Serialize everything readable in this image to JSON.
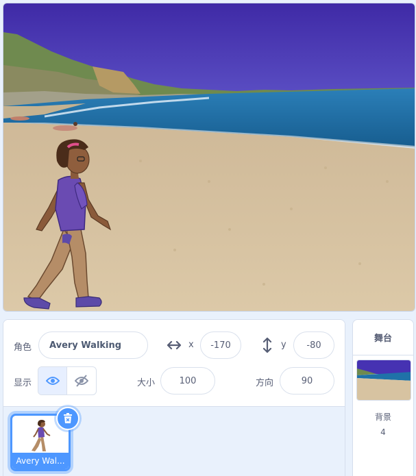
{
  "sprite_info": {
    "sprite_label": "角色",
    "sprite_name": "Avery Walking",
    "x_label": "x",
    "x_value": "-170",
    "y_label": "y",
    "y_value": "-80",
    "show_label": "显示",
    "size_label": "大小",
    "size_value": "100",
    "direction_label": "方向",
    "direction_value": "90"
  },
  "sprite_list": [
    {
      "name": "Avery Wal...",
      "selected": true
    }
  ],
  "stage_selector": {
    "title": "舞台",
    "backdrops_label": "背景",
    "backdrops_count": "4"
  },
  "colors": {
    "accent": "#4d97ff",
    "sky": "#4632b2",
    "sea": "#1b6fa3",
    "sand": "#d7c3a1"
  },
  "icons": [
    "x-arrows-icon",
    "y-arrows-icon",
    "eye-icon",
    "eye-slash-icon",
    "trash-icon"
  ]
}
